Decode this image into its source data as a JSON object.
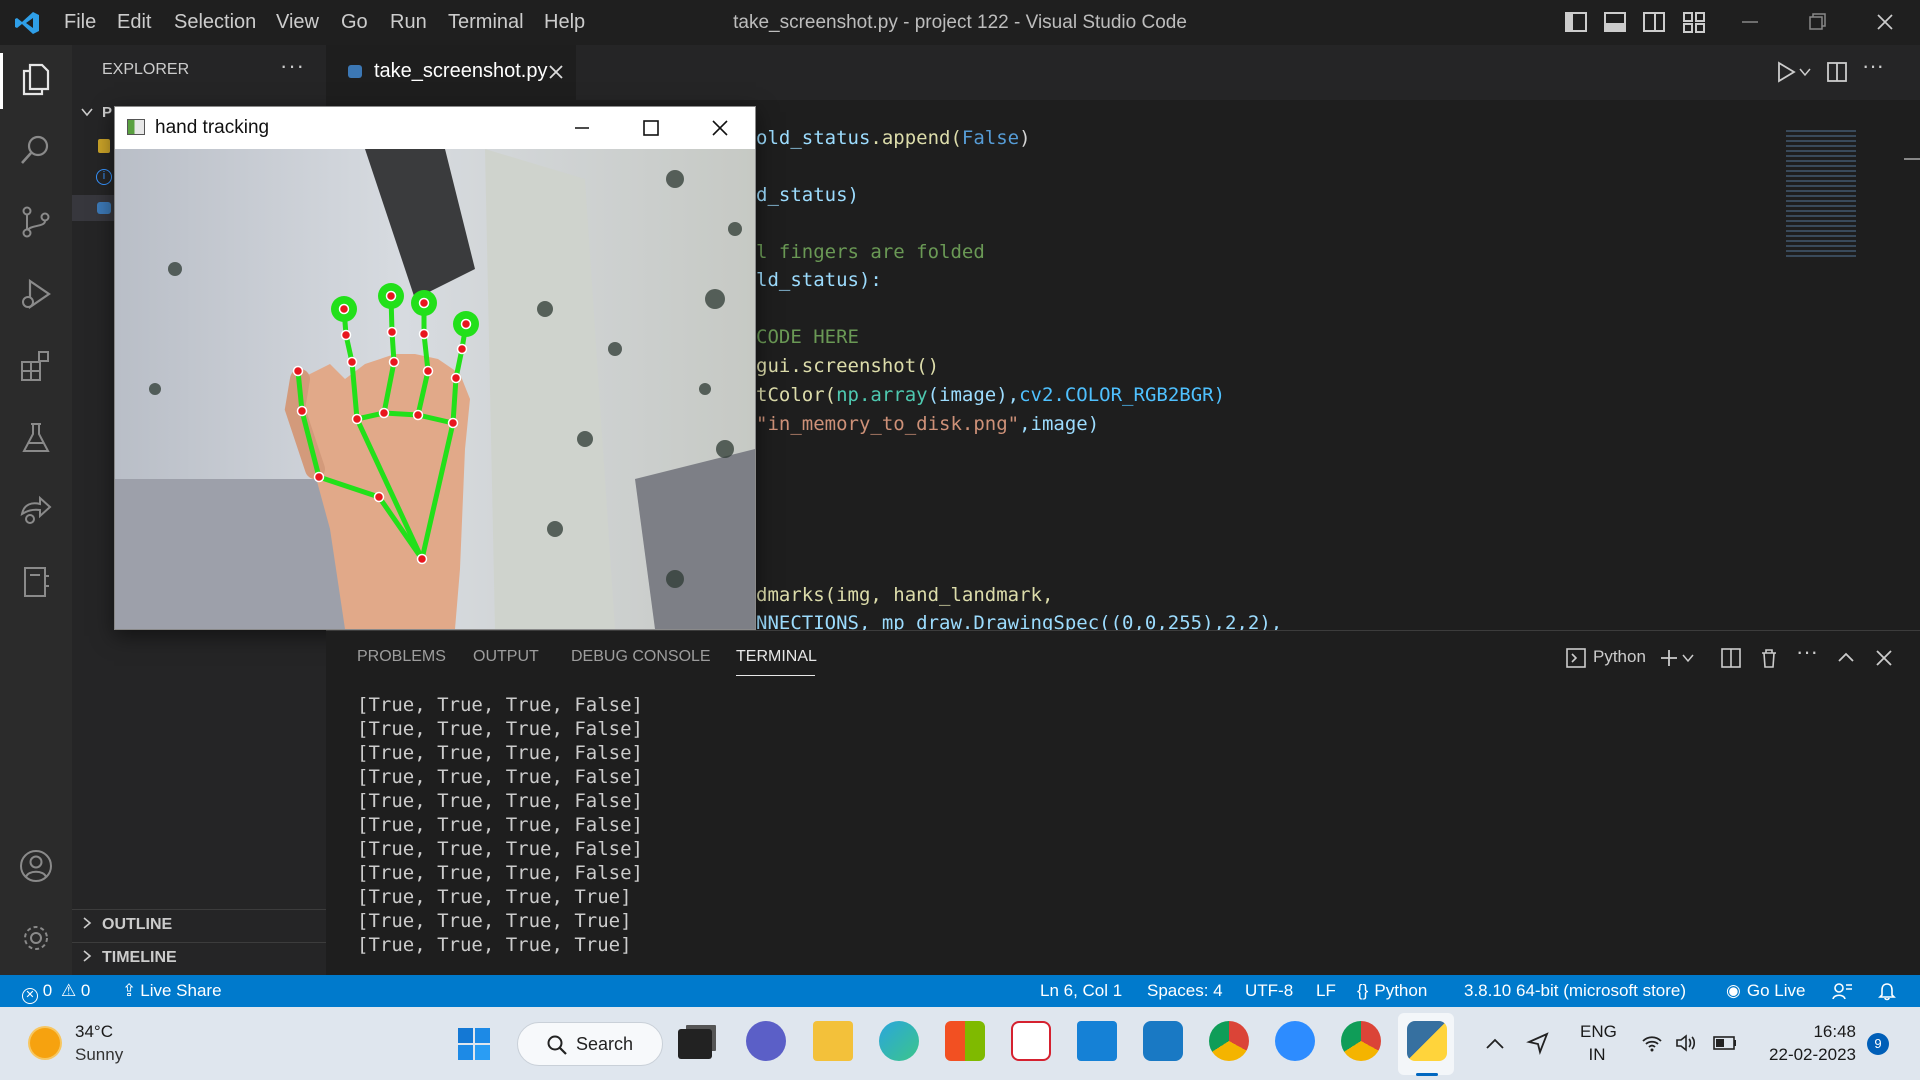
{
  "window": {
    "title": "take_screenshot.py - project 122 - Visual Studio Code",
    "menu": [
      "File",
      "Edit",
      "Selection",
      "View",
      "Go",
      "Run",
      "Terminal",
      "Help"
    ]
  },
  "sidebar": {
    "header": "EXPLORER",
    "folder_initial": "P",
    "outline_label": "OUTLINE",
    "timeline_label": "TIMELINE"
  },
  "editor": {
    "tab_label": "take_screenshot.py",
    "code_lines": [
      {
        "a": "old_status",
        "b": ".append(",
        "c": "False",
        "d": ")"
      },
      {
        "a": "d_status)"
      },
      {
        "comment": "l fingers are folded"
      },
      {
        "a": "ld_status):"
      },
      {
        "comment": "CODE HERE"
      },
      {
        "a": "gui.screenshot()"
      },
      {
        "a": "tColor(",
        "b": "np.array",
        "c": "(image),",
        "d": "cv2.COLOR_RGB2BGR)"
      },
      {
        "s": "\"in_memory_to_disk.png\"",
        "t": ",image)"
      },
      {
        "a": "dmarks(img, hand_landmark,"
      },
      {
        "a": "NNECTIONS, mp_draw.DrawingSpec((0,0,255),2,2),"
      }
    ]
  },
  "popup": {
    "title": "hand tracking"
  },
  "panel": {
    "tabs": [
      "PROBLEMS",
      "OUTPUT",
      "DEBUG CONSOLE",
      "TERMINAL"
    ],
    "active_tab": "TERMINAL",
    "terminal_profile": "Python",
    "terminal_lines": [
      "[True, True, True, False]",
      "[True, True, True, False]",
      "[True, True, True, False]",
      "[True, True, True, False]",
      "[True, True, True, False]",
      "[True, True, True, False]",
      "[True, True, True, False]",
      "[True, True, True, False]",
      "[True, True, True, True]",
      "[True, True, True, True]",
      "[True, True, True, True]"
    ]
  },
  "statusbar": {
    "errors": "0",
    "warnings": "0",
    "live_share": "Live Share",
    "position": "Ln 6, Col 1",
    "spaces": "Spaces: 4",
    "encoding": "UTF-8",
    "eol": "LF",
    "language": "Python",
    "interpreter": "3.8.10 64-bit (microsoft store)",
    "go_live": "Go Live"
  },
  "taskbar": {
    "weather_temp": "34°C",
    "weather_desc": "Sunny",
    "search_label": "Search",
    "lang_top": "ENG",
    "lang_bottom": "IN",
    "time": "16:48",
    "date": "22-02-2023",
    "notification_count": "9"
  },
  "colors": {
    "accent": "#007acc",
    "landmark_line": "#22e01a",
    "landmark_point": "#e8161e"
  }
}
